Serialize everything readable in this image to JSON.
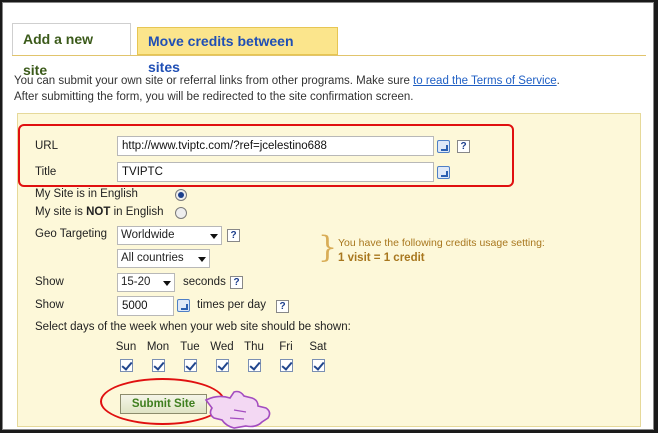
{
  "tabs": [
    {
      "label": "Add a new site",
      "active": true
    },
    {
      "label": "Move credits between sites",
      "active": false
    }
  ],
  "intro": {
    "line1_prefix": "You can submit your own site or referral links from other programs. Make sure ",
    "terms_link": "to read the Terms of Service",
    "line1_suffix": ".",
    "line2": "After submitting the form, you will be redirected to the site confirmation screen."
  },
  "form": {
    "url_label": "URL",
    "url_value": "http://www.tviptc.com/?ref=jcelestino688",
    "title_label": "Title",
    "title_value": "TVIPTC",
    "english_label": "My Site is in English",
    "not_english_prefix": "My site is ",
    "not_english_bold": "NOT",
    "not_english_suffix": " in English",
    "geo_label": "Geo Targeting",
    "geo_value": "Worldwide",
    "countries_value": "All countries",
    "show_label": "Show",
    "seconds_value": "15-20",
    "seconds_unit": "seconds",
    "show_label2": "Show",
    "times_value": "5000",
    "times_unit": "times per day",
    "days_prompt": "Select days of the week when your web site should be shown:",
    "days": [
      "Sun",
      "Mon",
      "Tue",
      "Wed",
      "Thu",
      "Fri",
      "Sat"
    ],
    "submit_label": "Submit Site",
    "help_glyph": "?"
  },
  "credits": {
    "line1": "You have the following credits usage setting:",
    "line2": "1 visit = 1 credit"
  },
  "colors": {
    "annotation": "#e01010",
    "tab_active_text": "#3b5a1a",
    "tab_inactive_text": "#1f4fb5"
  }
}
